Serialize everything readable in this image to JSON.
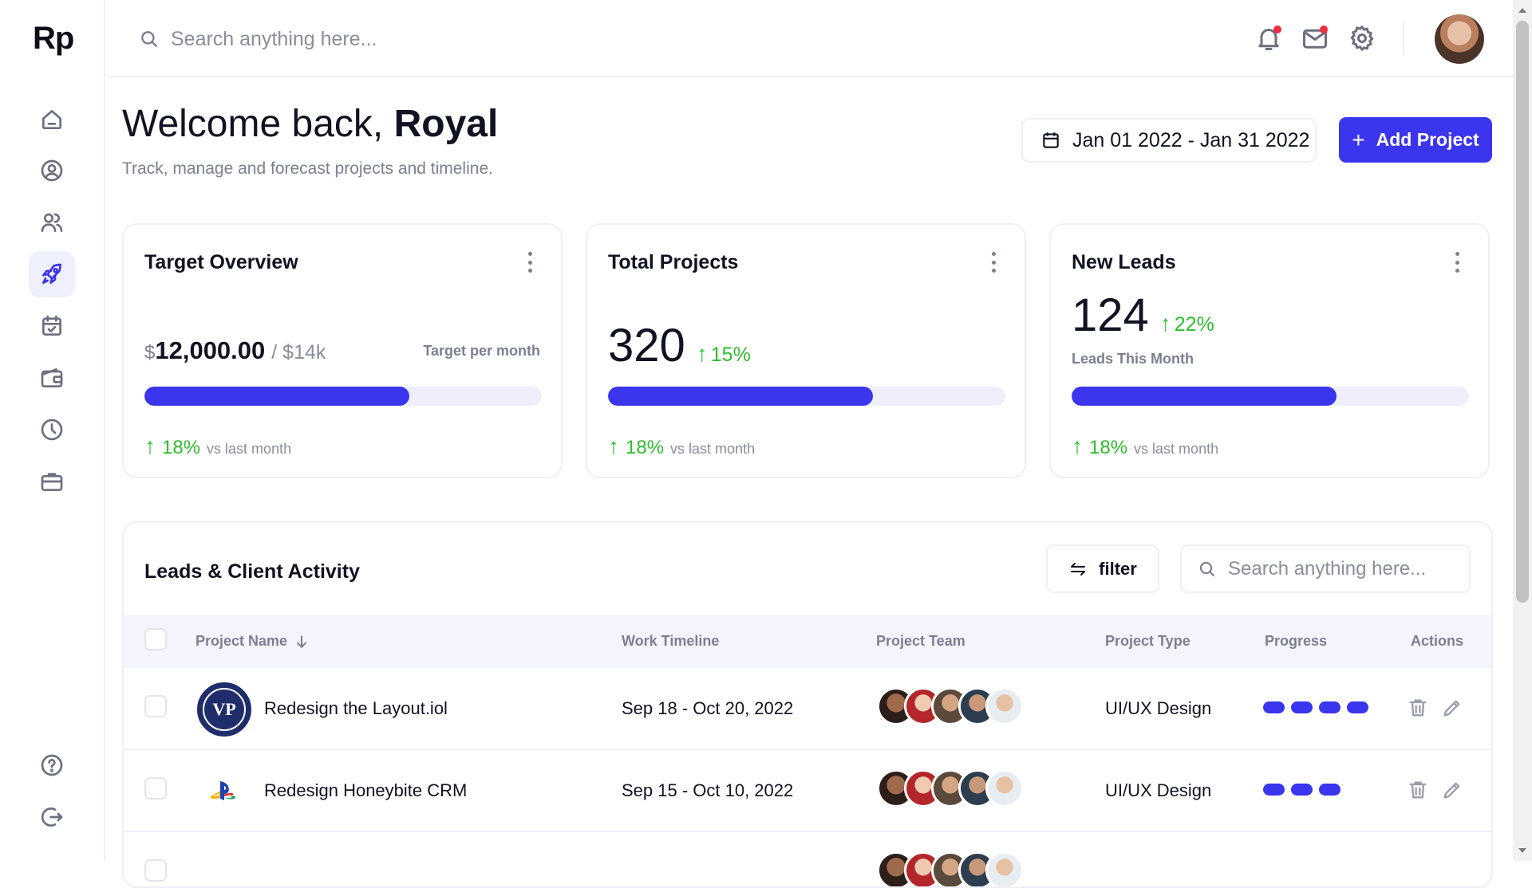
{
  "brand": {
    "logo_text": "Rp"
  },
  "sidebar": {
    "items": [
      {
        "name": "home",
        "icon": "home-icon",
        "active": false
      },
      {
        "name": "profile",
        "icon": "user-circle-icon",
        "active": false
      },
      {
        "name": "team",
        "icon": "users-icon",
        "active": false
      },
      {
        "name": "projects",
        "icon": "rocket-icon",
        "active": true
      },
      {
        "name": "calendar",
        "icon": "calendar-check-icon",
        "active": false
      },
      {
        "name": "wallet",
        "icon": "wallet-icon",
        "active": false
      },
      {
        "name": "history",
        "icon": "clock-icon",
        "active": false
      },
      {
        "name": "portfolio",
        "icon": "briefcase-icon",
        "active": false
      }
    ],
    "bottom_items": [
      {
        "name": "help",
        "icon": "help-icon"
      },
      {
        "name": "logout",
        "icon": "logout-icon"
      }
    ]
  },
  "topbar": {
    "search_placeholder": "Search anything here...",
    "icons": [
      "bell-icon",
      "mail-icon",
      "gear-icon"
    ],
    "notification_dot_color": "#ee2d3d"
  },
  "header": {
    "greeting": "Welcome back, ",
    "user_name": "Royal",
    "subtitle": "Track, manage and forecast projects and timeline.",
    "date_range": "Jan 01 2022 - Jan 31 2022",
    "add_button_label": "Add Project",
    "add_button_plus": "+"
  },
  "cards": {
    "target": {
      "title": "Target Overview",
      "currency": "$",
      "amount": "12,000.00",
      "of_target": "/ $14k",
      "target_label": "Target per month",
      "progress": 0.667,
      "delta_arrow": "↑",
      "delta_pct": "18%",
      "delta_text": "vs last month"
    },
    "projects": {
      "title": "Total Projects",
      "value": "320",
      "change_arrow": "↑",
      "change": "15%",
      "progress": 0.667,
      "delta_arrow": "↑",
      "delta_pct": "18%",
      "delta_text": "vs last month"
    },
    "leads": {
      "title": "New Leads",
      "value": "124",
      "change_arrow": "↑",
      "change": "22%",
      "subtitle": "Leads This Month",
      "progress": 0.667,
      "delta_arrow": "↑",
      "delta_pct": "18%",
      "delta_text": "vs last month"
    }
  },
  "activity": {
    "title": "Leads & Client Activity",
    "filter_label": "filter",
    "search_placeholder": "Search anything here...",
    "columns": {
      "project_name": "Project Name",
      "work_timeline": "Work Timeline",
      "project_team": "Project Team",
      "project_type": "Project Type",
      "progress": "Progress",
      "actions": "Actions"
    },
    "rows": [
      {
        "name": "Redesign the Layout.iol",
        "timeline": "Sep 18 - Oct 20, 2022",
        "type": "UI/UX Design",
        "progress_segments": 4,
        "logo": "seal-logo"
      },
      {
        "name": "Redesign Honeybite CRM",
        "timeline": "Sep 15 - Oct 10, 2022",
        "type": "UI/UX Design",
        "progress_segments": 3,
        "logo": "playstation-logo"
      }
    ]
  },
  "colors": {
    "accent": "#3b35ee",
    "positive": "#2dbe2d",
    "muted": "#7b7f90"
  }
}
